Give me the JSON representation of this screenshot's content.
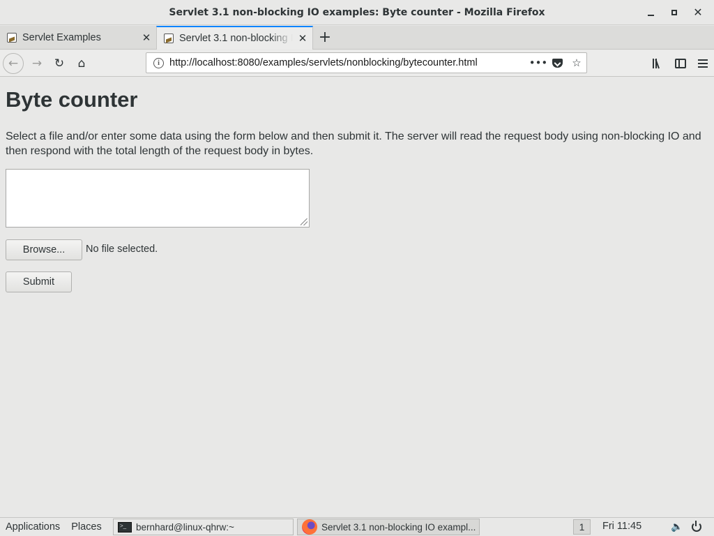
{
  "window": {
    "title": "Servlet 3.1 non-blocking IO examples: Byte counter - Mozilla Firefox",
    "minimize_icon": "minimize-icon",
    "maximize_icon": "maximize-icon",
    "close_icon": "close-icon"
  },
  "tabs": [
    {
      "label": "Servlet Examples",
      "active": false,
      "close": "✕"
    },
    {
      "label": "Servlet 3.1 non-blocking IO examples: Byte counter",
      "active": true,
      "close": "✕"
    }
  ],
  "new_tab_label": "+",
  "navbar": {
    "url": "http://localhost:8080/examples/servlets/nonblocking/bytecounter.html",
    "page_actions": "•••",
    "bookmark_glyph": "☆"
  },
  "page": {
    "title": "Byte counter",
    "intro": "Select a file and/or enter some data using the form below and then submit it. The server will read the request body using non-blocking IO and then respond with the total length of the request body in bytes.",
    "textarea_value": "",
    "browse_label": "Browse...",
    "file_status": "No file selected.",
    "submit_label": "Submit"
  },
  "taskbar": {
    "applications": "Applications",
    "places": "Places",
    "terminal_task": "bernhard@linux-qhrw:~",
    "firefox_task": "Servlet 3.1 non-blocking IO exampl...",
    "workspace": "1",
    "clock": "Fri 11:45"
  },
  "colors": {
    "active_tab_accent": "#0a84ff",
    "background": "#e8e8e7",
    "text": "#2e3436"
  }
}
